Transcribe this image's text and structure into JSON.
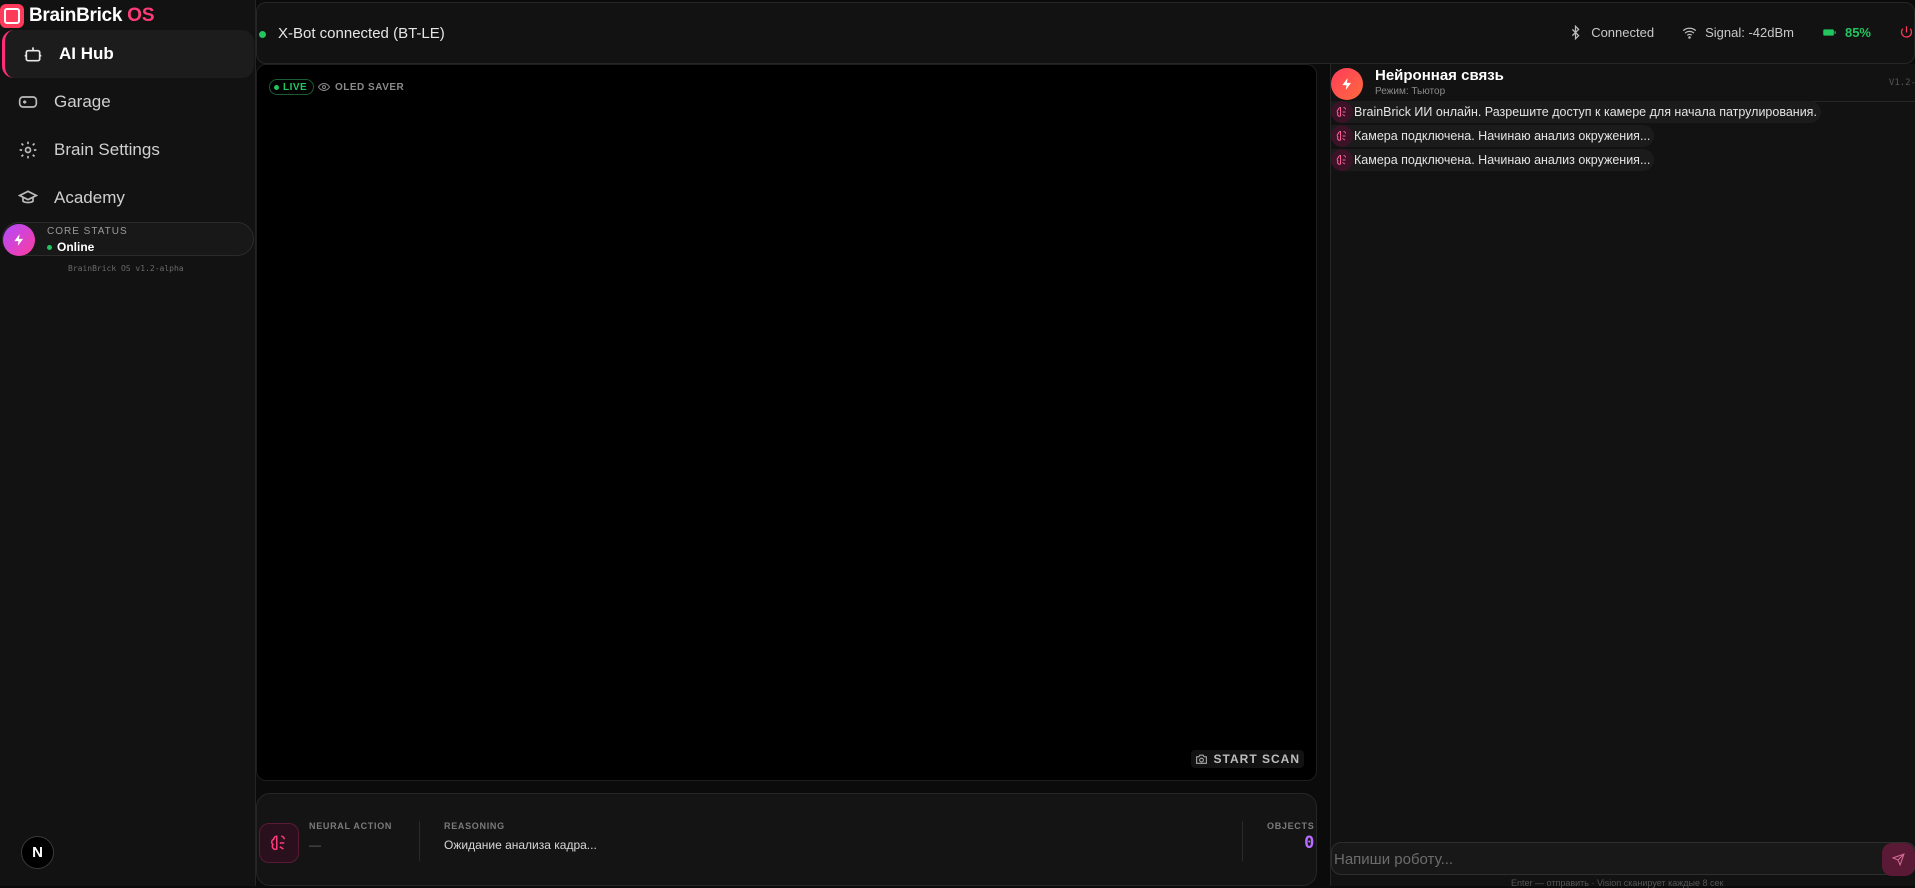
{
  "brand": {
    "name": "BrainBrick",
    "accent": "OS"
  },
  "sidebar": {
    "items": [
      {
        "label": "AI Hub",
        "icon": "robot-icon",
        "active": true
      },
      {
        "label": "Garage",
        "icon": "gamepad-icon",
        "active": false
      },
      {
        "label": "Brain Settings",
        "icon": "gear-icon",
        "active": false
      },
      {
        "label": "Academy",
        "icon": "graduation-cap-icon",
        "active": false
      }
    ],
    "core": {
      "label": "CORE STATUS",
      "status": "Online"
    },
    "version": "BrainBrick OS v1.2-alpha",
    "avatar_letter": "N"
  },
  "topbar": {
    "connection": "X-Bot connected (BT-LE)",
    "bluetooth": "Connected",
    "signal": "Signal: -42dBm",
    "battery": "85%"
  },
  "camera": {
    "live": "LIVE",
    "oled": "OLED SAVER",
    "scan": "START SCAN"
  },
  "analysis": {
    "action_label": "NEURAL ACTION",
    "action_value": "—",
    "reasoning_label": "REASONING",
    "reasoning_value": "Ожидание анализа кадра...",
    "objects_label": "OBJECTS",
    "objects_value": "0"
  },
  "chat": {
    "title": "Нейронная связь",
    "subtitle": "Режим: Тьютор",
    "version": "V1.2-",
    "messages": [
      "BrainBrick ИИ онлайн. Разрешите доступ к камере для начала патрулирования.",
      "Камера подключена. Начинаю анализ окружения...",
      "Камера подключена. Начинаю анализ окружения..."
    ],
    "placeholder": "Напиши роботу...",
    "hint": "Enter — отправить · Vision сканирует каждые 8 сек"
  },
  "colors": {
    "accent": "#ff2d78",
    "online": "#22c55e",
    "objects": "#b76bff"
  }
}
